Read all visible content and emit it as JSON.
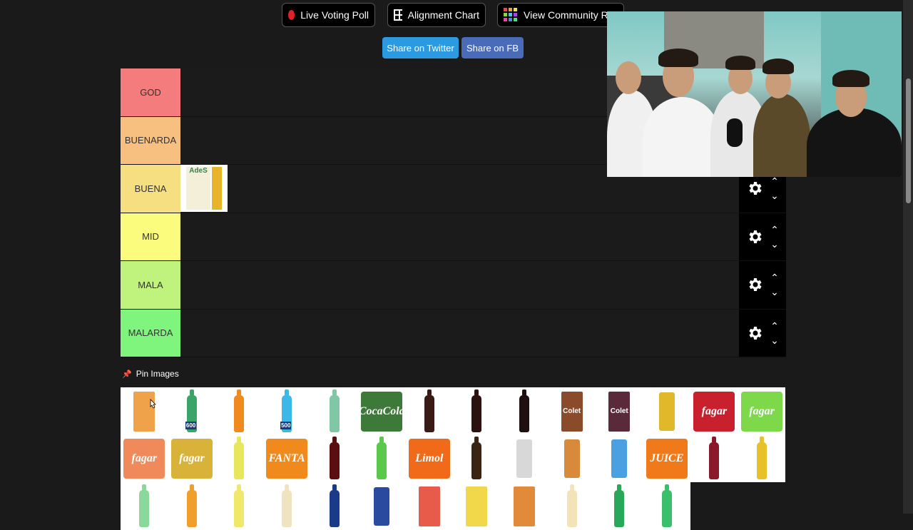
{
  "toolbar": {
    "live_voting": "Live Voting Poll",
    "alignment_chart": "Alignment Chart",
    "community_rankings": "View Community Ra"
  },
  "share": {
    "twitter": "Share on Twitter",
    "fb": "Share on FB"
  },
  "tiers": [
    {
      "label": "GOD",
      "color": "#f47c7c"
    },
    {
      "label": "BUENARDA",
      "color": "#f7bf80"
    },
    {
      "label": "BUENA",
      "color": "#f6df80"
    },
    {
      "label": "MID",
      "color": "#fbfb7e"
    },
    {
      "label": "MALA",
      "color": "#c0f27e"
    },
    {
      "label": "MALARDA",
      "color": "#80f57e"
    }
  ],
  "tier_items": {
    "BUENA": [
      {
        "name": "ades-anana",
        "brand_text": "AdeS"
      }
    ]
  },
  "pin_images": {
    "label": "Pin Images"
  },
  "pool_items": [
    {
      "icon": "ades-orange-bottle",
      "kind": "box",
      "color": "#f0a24a"
    },
    {
      "icon": "agua-salus-bottle",
      "kind": "bottle",
      "color": "#3aa46a",
      "text": "600"
    },
    {
      "icon": "aquarius-orange-bottle",
      "kind": "bottle",
      "color": "#f08a1c"
    },
    {
      "icon": "blue-sports-drink-bottle",
      "kind": "bottle",
      "color": "#3bb8e8",
      "text": "500"
    },
    {
      "icon": "arizona-green-tea-bottle",
      "kind": "bottle",
      "color": "#7fc7a5"
    },
    {
      "icon": "coca-cola-life-bottle",
      "kind": "pack",
      "color": "#3d7a3a",
      "text": "CocaCola"
    },
    {
      "icon": "coca-cola-small-bottle",
      "kind": "bottle",
      "color": "#3a1a14"
    },
    {
      "icon": "coca-cola-bottle",
      "kind": "bottle",
      "color": "#2b120f"
    },
    {
      "icon": "coca-cola-zero-bottle",
      "kind": "bottle",
      "color": "#1e1010"
    },
    {
      "icon": "colet-box",
      "kind": "box",
      "color": "#8a4b2a",
      "text": "Colet"
    },
    {
      "icon": "colet-dark-box",
      "kind": "box",
      "color": "#5b2a3a",
      "text": "Colet"
    },
    {
      "icon": "energy-can",
      "kind": "can",
      "color": "#e0b82a"
    },
    {
      "icon": "fagar-red-pack",
      "kind": "pack",
      "color": "#c8202c",
      "text": "fagar"
    },
    {
      "icon": "fagar-green-pack",
      "kind": "pack",
      "color": "#7dd84a",
      "text": "fagar"
    },
    {
      "icon": "fagar-orange-pack",
      "kind": "pack",
      "color": "#f08a5a",
      "text": "fagar"
    },
    {
      "icon": "fagar-yellow-pack",
      "kind": "pack",
      "color": "#d9b23a",
      "text": "fagar"
    },
    {
      "icon": "fanta-lemon-bottle",
      "kind": "bottle",
      "color": "#e8e65a"
    },
    {
      "icon": "fanta-orange-bottle",
      "kind": "pack",
      "color": "#f08a1c",
      "text": "FANTA"
    },
    {
      "icon": "limol-cola-bottle",
      "kind": "bottle",
      "color": "#5a0e10"
    },
    {
      "icon": "limol-lima-bottle",
      "kind": "bottle",
      "color": "#5ac84a"
    },
    {
      "icon": "limol-orange-bottle",
      "kind": "pack",
      "color": "#f06a1a",
      "text": "Limol"
    },
    {
      "icon": "malta-bottle",
      "kind": "bottle",
      "color": "#3a2414"
    },
    {
      "icon": "monster-white-can",
      "kind": "can",
      "color": "#d8d8d8"
    },
    {
      "icon": "monster-orange-can",
      "kind": "can",
      "color": "#d88a3a"
    },
    {
      "icon": "monster-blue-can",
      "kind": "can",
      "color": "#4aa0e0"
    },
    {
      "icon": "monster-juice-can",
      "kind": "pack",
      "color": "#f07a1a",
      "text": "JUICE"
    },
    {
      "icon": "cola-red-bottle",
      "kind": "bottle",
      "color": "#8a1a2a"
    },
    {
      "icon": "yellow-soda-bottle",
      "kind": "bottle",
      "color": "#e8c02a"
    },
    {
      "icon": "green-soda-bottle",
      "kind": "bottle",
      "color": "#8ad89a"
    },
    {
      "icon": "orange-soda-bottle",
      "kind": "bottle",
      "color": "#f0a02a"
    },
    {
      "icon": "lemon-soda-bottle",
      "kind": "bottle",
      "color": "#f0e86a"
    },
    {
      "icon": "tonica-bottle",
      "kind": "bottle",
      "color": "#f0e4c0"
    },
    {
      "icon": "pepsi-bottle",
      "kind": "bottle",
      "color": "#1a3a8a"
    },
    {
      "icon": "red-bull-can",
      "kind": "can",
      "color": "#2a4aa0"
    },
    {
      "icon": "apple-juice-box",
      "kind": "box",
      "color": "#e85a4a"
    },
    {
      "icon": "lemon-juice-box",
      "kind": "box",
      "color": "#f0d84a"
    },
    {
      "icon": "sin-azucares-box",
      "kind": "box",
      "color": "#e08a3a"
    },
    {
      "icon": "pomelo-bottle",
      "kind": "bottle",
      "color": "#f2e4b8"
    },
    {
      "icon": "sprite-zero-bottle",
      "kind": "bottle",
      "color": "#2aa85a"
    },
    {
      "icon": "sprite-bottle",
      "kind": "bottle",
      "color": "#3ac06a"
    }
  ]
}
